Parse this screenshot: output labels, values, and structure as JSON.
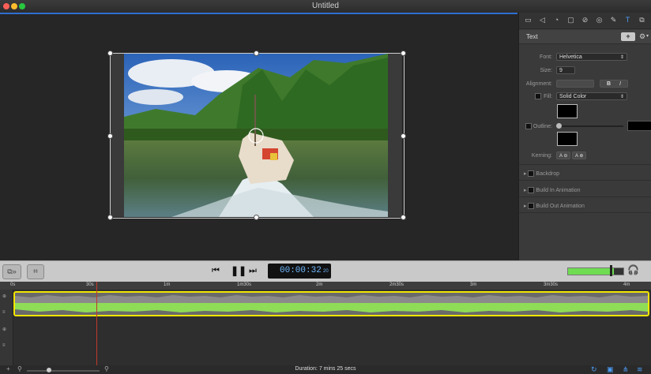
{
  "window": {
    "title": "Untitled"
  },
  "inspector": {
    "panel_title": "Text",
    "add_label": "+",
    "font": {
      "label": "Font:",
      "value": "Helvetica"
    },
    "size": {
      "label": "Size:",
      "value": "9"
    },
    "alignment": {
      "label": "Alignment:",
      "bold": "B",
      "italic": "I"
    },
    "fill": {
      "label": "Fill:",
      "value": "Solid Color",
      "color": "#000000"
    },
    "outline": {
      "label": "Outline:",
      "color": "#000000"
    },
    "kerning": {
      "label": "Kerning:",
      "left_btn": "A ⊖",
      "right_btn": "A ⊕"
    },
    "sections": [
      "Backdrop",
      "Build In Animation",
      "Build Out Animation"
    ]
  },
  "transport": {
    "timecode": "00:00:32",
    "frames": "20"
  },
  "ruler": {
    "labels": [
      "0s",
      "30s",
      "1m",
      "1m30s",
      "2m",
      "2m30s",
      "3m",
      "3m30s",
      "4m"
    ]
  },
  "status": {
    "duration": "Duration: 7 mins 25 secs"
  },
  "colors": {
    "accent": "#2f6fd1",
    "clip_border": "#f2e600",
    "waveform": "#8fdc57",
    "playhead": "#c0392b"
  }
}
